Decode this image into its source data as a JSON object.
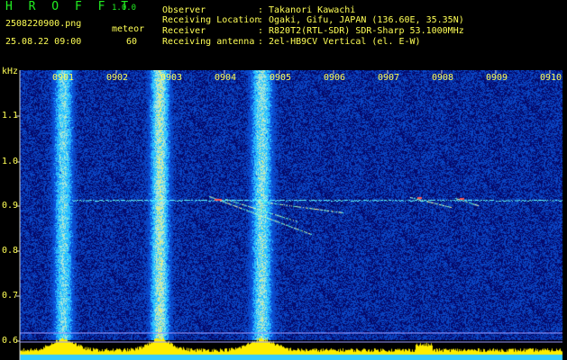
{
  "app": {
    "title": "H R O F F T",
    "version": "1.0.0",
    "filename": "2508220900.png",
    "mode": "meteor",
    "datetime": "25.08.22 09:00",
    "count": "60"
  },
  "info": [
    {
      "label": "Observer",
      "value": "Takanori Kawachi"
    },
    {
      "label": "Receiving Location",
      "value": "Ogaki, Gifu, JAPAN (136.60E, 35.35N)"
    },
    {
      "label": "Receiver",
      "value": "R820T2(RTL-SDR) SDR-Sharp 53.1000MHz"
    },
    {
      "label": "Receiving antenna",
      "value": "2el-HB9CV Vertical (el. E-W)"
    }
  ],
  "axis": {
    "y_unit": "kHz",
    "y_ticks": [
      "1.1",
      "1.0",
      "0.9",
      "0.8",
      "0.7",
      "0.6"
    ],
    "x_ticks": [
      "0901",
      "0902",
      "0903",
      "0904",
      "0905",
      "0906",
      "0907",
      "0908",
      "0909",
      "0910"
    ]
  },
  "colors": {
    "background": "#000000",
    "text": "#ffff55",
    "title": "#22ee22",
    "noise_low": "#0a1a8a",
    "noise_mid": "#1f5cff",
    "carrier": "#66ffff",
    "level_bar": "#ffee00",
    "floor": "#33ccff"
  }
}
